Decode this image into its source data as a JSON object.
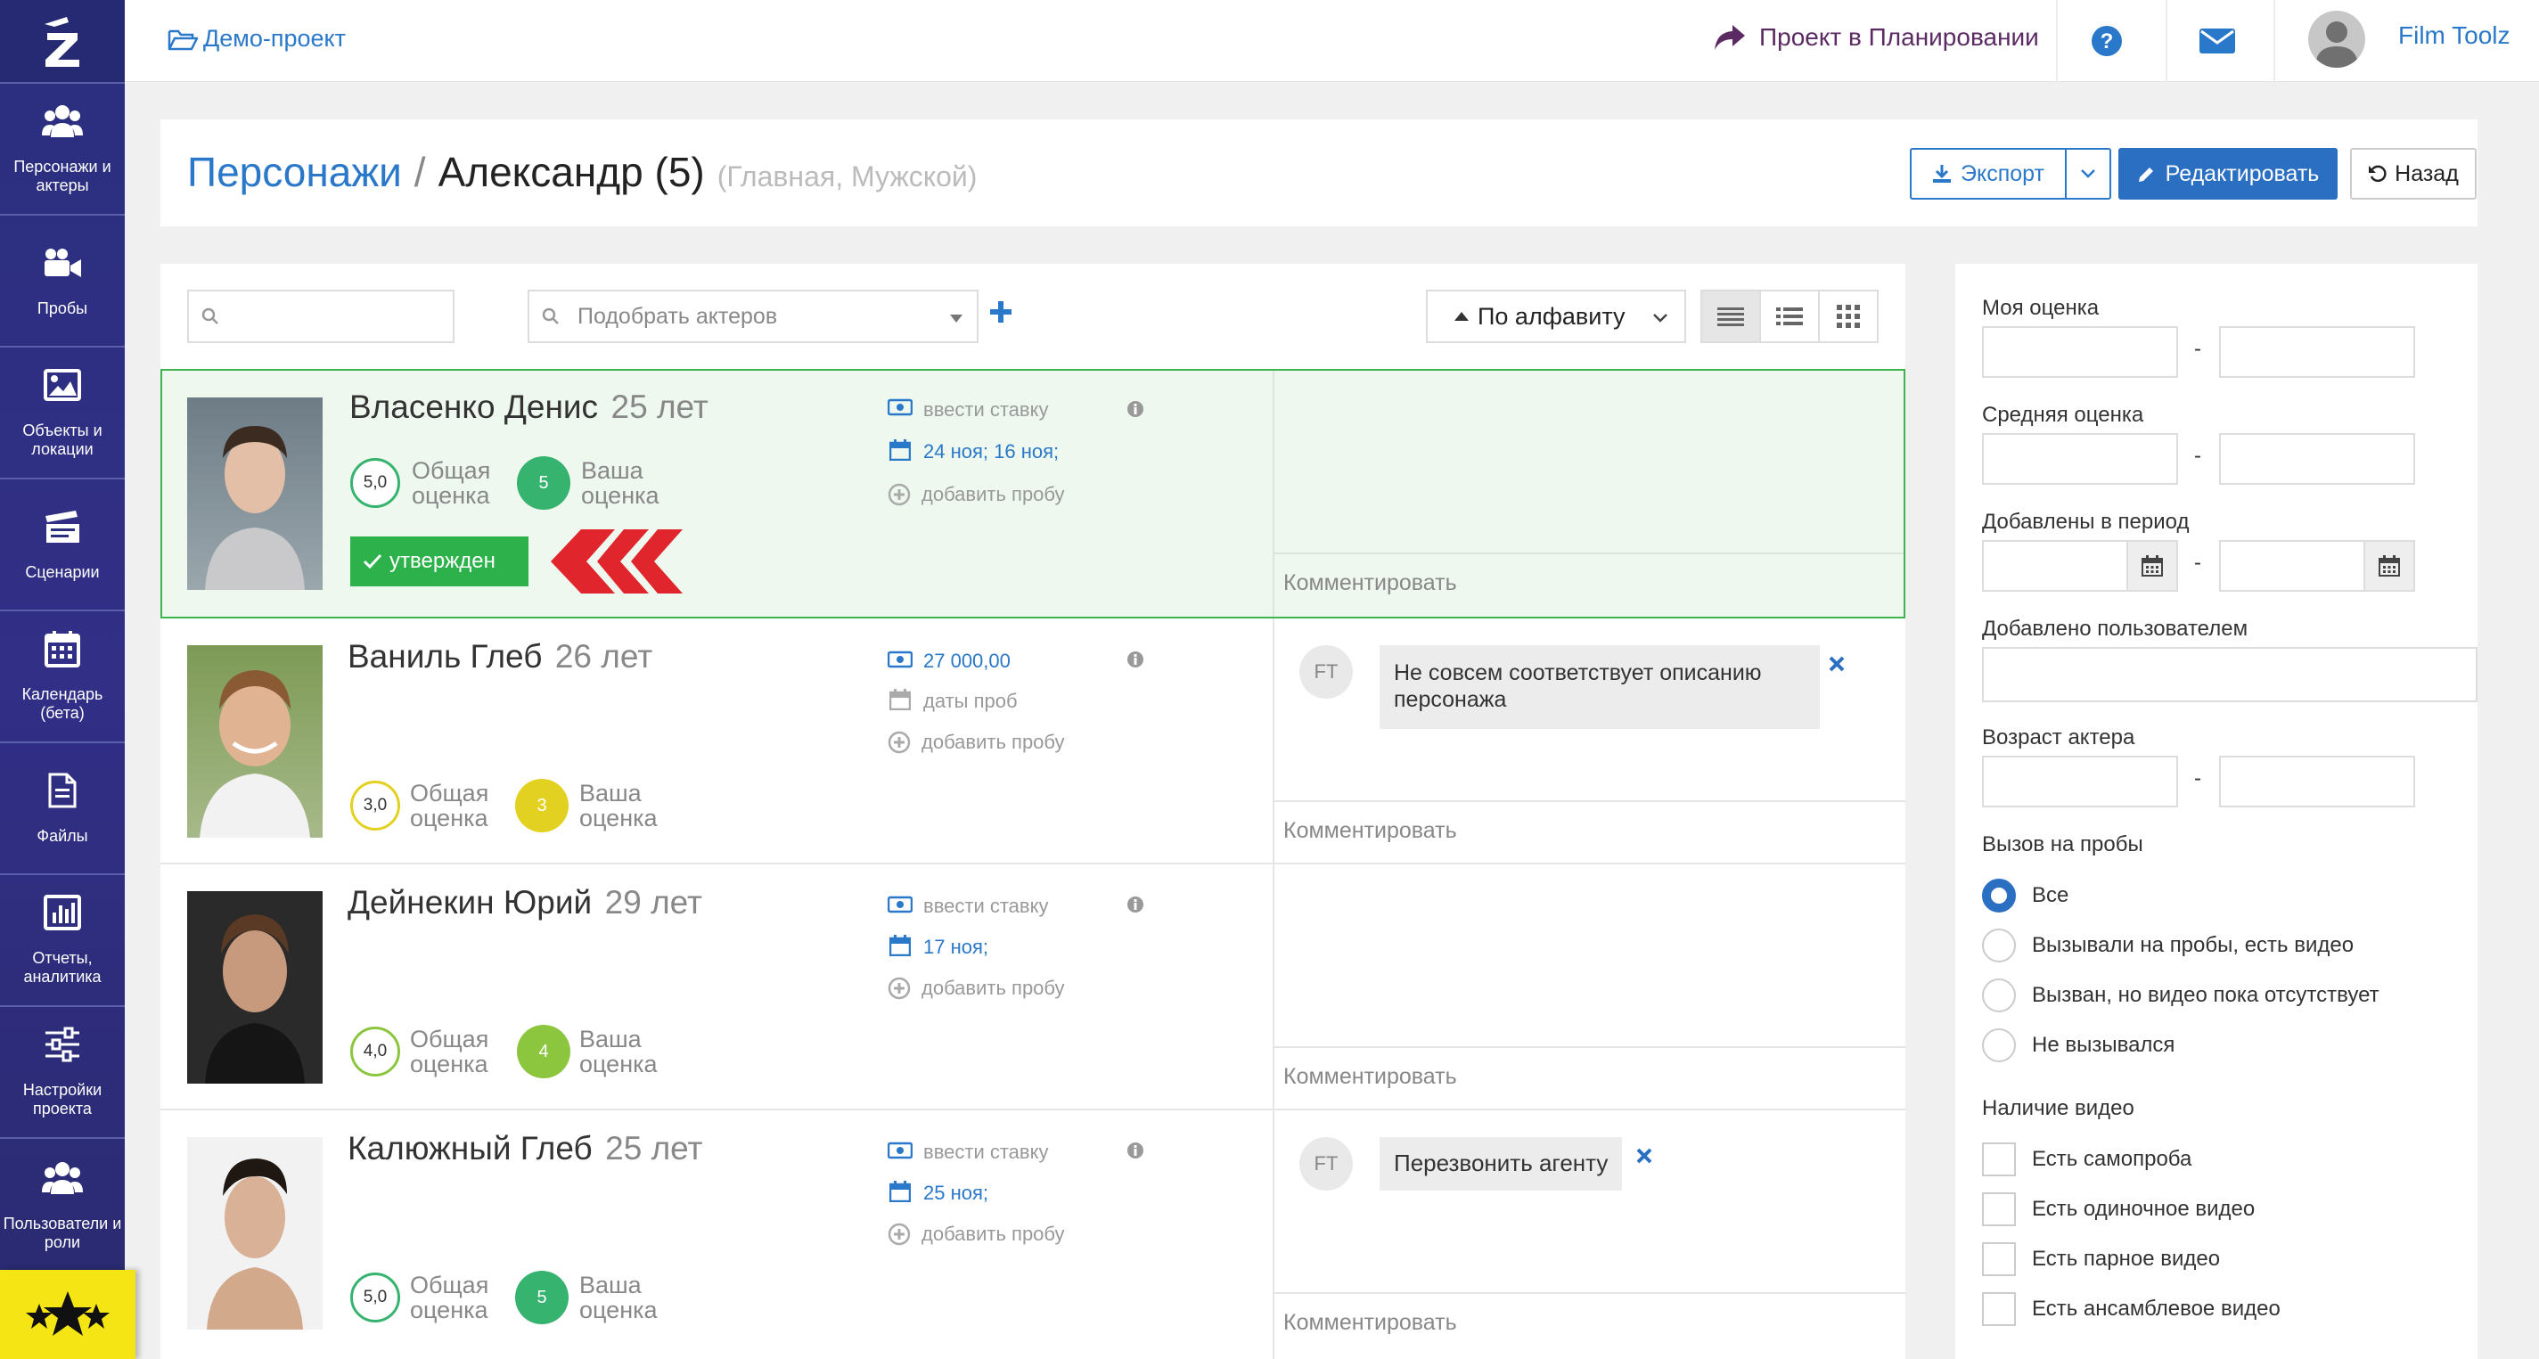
{
  "topbar": {
    "project_link": "Демо-проект",
    "status": "Проект в Планировании",
    "username": "Film Toolz"
  },
  "sidebar": {
    "items": [
      {
        "label": "Персонажи и\nактеры",
        "icon": "users-icon"
      },
      {
        "label": "Пробы",
        "icon": "video-camera-icon"
      },
      {
        "label": "Объекты и\nлокации",
        "icon": "image-icon"
      },
      {
        "label": "Сценарии",
        "icon": "clapperboard-icon"
      },
      {
        "label": "Календарь\n(бета)",
        "icon": "calendar-icon"
      },
      {
        "label": "Файлы",
        "icon": "file-icon"
      },
      {
        "label": "Отчеты,\nаналитика",
        "icon": "chart-icon"
      },
      {
        "label": "Настройки\nпроекта",
        "icon": "sliders-icon"
      },
      {
        "label": "Пользователи и\nроли",
        "icon": "users-icon"
      }
    ]
  },
  "header": {
    "breadcrumb_root": "Персонажи",
    "separator": "/",
    "title": "Александр (5)",
    "subtitle": "(Главная, Мужской)",
    "export_label": "Экспорт",
    "edit_label": "Редактировать",
    "back_label": "Назад"
  },
  "toolbar": {
    "search_placeholder": "",
    "pick_placeholder": "Подобрать актеров",
    "sort_label": "По алфавиту"
  },
  "common": {
    "overall_line1": "Общая",
    "overall_line2": "оценка",
    "your_line1": "Ваша",
    "your_line2": "оценка",
    "add_probe": "добавить пробу",
    "comment_placeholder": "Комментировать"
  },
  "actors": [
    {
      "name": "Власенко Денис",
      "age": "25 лет",
      "overall": "5,0",
      "yours": "5",
      "rate": "ввести ставку",
      "dates": "24 ноя; 16 ноя;",
      "approved": "утвержден",
      "comments": []
    },
    {
      "name": "Ваниль Глеб",
      "age": "26 лет",
      "overall": "3,0",
      "yours": "3",
      "rate": "27 000,00",
      "dates": "даты проб",
      "approved": "",
      "comments": [
        {
          "author": "FT",
          "text": "Не совсем соответствует описанию персонажа"
        }
      ]
    },
    {
      "name": "Дейнекин Юрий",
      "age": "29 лет",
      "overall": "4,0",
      "yours": "4",
      "rate": "ввести ставку",
      "dates": "17 ноя;",
      "approved": "",
      "comments": []
    },
    {
      "name": "Калюжный Глеб",
      "age": "25 лет",
      "overall": "5,0",
      "yours": "5",
      "rate": "ввести ставку",
      "dates": "25 ноя;",
      "approved": "",
      "comments": [
        {
          "author": "FT",
          "text": "Перезвонить агенту"
        }
      ]
    }
  ],
  "filters": {
    "my_rating": "Моя оценка",
    "avg_rating": "Средняя оценка",
    "added_period": "Добавлены в период",
    "added_by": "Добавлено пользователем",
    "actor_age": "Возраст актера",
    "range_sep": "-",
    "audition_call": "Вызов на пробы",
    "audition_options": [
      "Все",
      "Вызывали на пробы, есть видео",
      "Вызван, но видео пока отсутствует",
      "Не вызывался"
    ],
    "audition_selected": 0,
    "video": "Наличие видео",
    "video_options": [
      "Есть самопроба",
      "Есть одиночное видео",
      "Есть парное видео",
      "Есть ансамблевое видео"
    ]
  },
  "colors": {
    "sidebar": "#2b2f7e",
    "primary": "#2a78c9",
    "approved": "#2db14a",
    "selected_row": "#eef8ee",
    "rating5": "#36b36f",
    "rating3": "#e3d122",
    "rating4": "#8cc63f",
    "arrow_red": "#e0262c"
  }
}
